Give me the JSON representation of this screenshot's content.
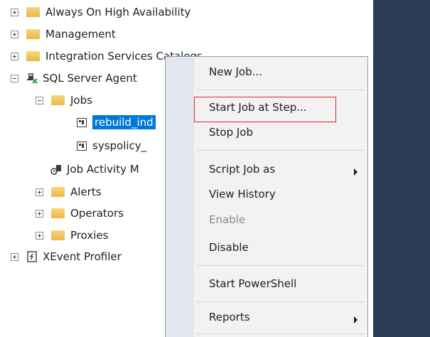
{
  "tree": {
    "always_on": "Always On High Availability",
    "management": "Management",
    "integration": "Integration Services Catalogs",
    "agent": "SQL Server Agent",
    "jobs": "Jobs",
    "job1": "rebuild_ind",
    "job2": "syspolicy_",
    "activity": "Job Activity M",
    "alerts": "Alerts",
    "operators": "Operators",
    "proxies": "Proxies",
    "xevent": "XEvent Profiler"
  },
  "context_menu": {
    "new_job": "New Job...",
    "start_job_at_step": "Start Job at Step...",
    "stop_job": "Stop Job",
    "script_job_as": "Script Job as",
    "view_history": "View History",
    "enable": "Enable",
    "disable": "Disable",
    "start_powershell": "Start PowerShell",
    "reports": "Reports"
  },
  "colors": {
    "selection": "#0078d7",
    "highlight_border": "#e0282e",
    "dark_panel": "#2e3d57"
  }
}
